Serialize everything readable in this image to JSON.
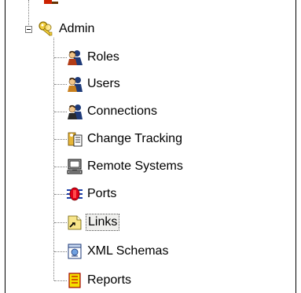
{
  "tree": {
    "root": {
      "label": "Admin",
      "icon": "key-icon",
      "expanded": true
    },
    "children": [
      {
        "label": "Roles",
        "icon": "users-group-icon"
      },
      {
        "label": "Users",
        "icon": "user-group-icon"
      },
      {
        "label": "Connections",
        "icon": "connections-group-icon"
      },
      {
        "label": "Change Tracking",
        "icon": "change-tracking-icon"
      },
      {
        "label": "Remote Systems",
        "icon": "computer-icon"
      },
      {
        "label": "Ports",
        "icon": "port-icon"
      },
      {
        "label": "Links",
        "icon": "link-icon",
        "selected": true
      },
      {
        "label": "XML Schemas",
        "icon": "xml-schema-icon"
      },
      {
        "label": "Reports",
        "icon": "reports-icon"
      }
    ]
  }
}
